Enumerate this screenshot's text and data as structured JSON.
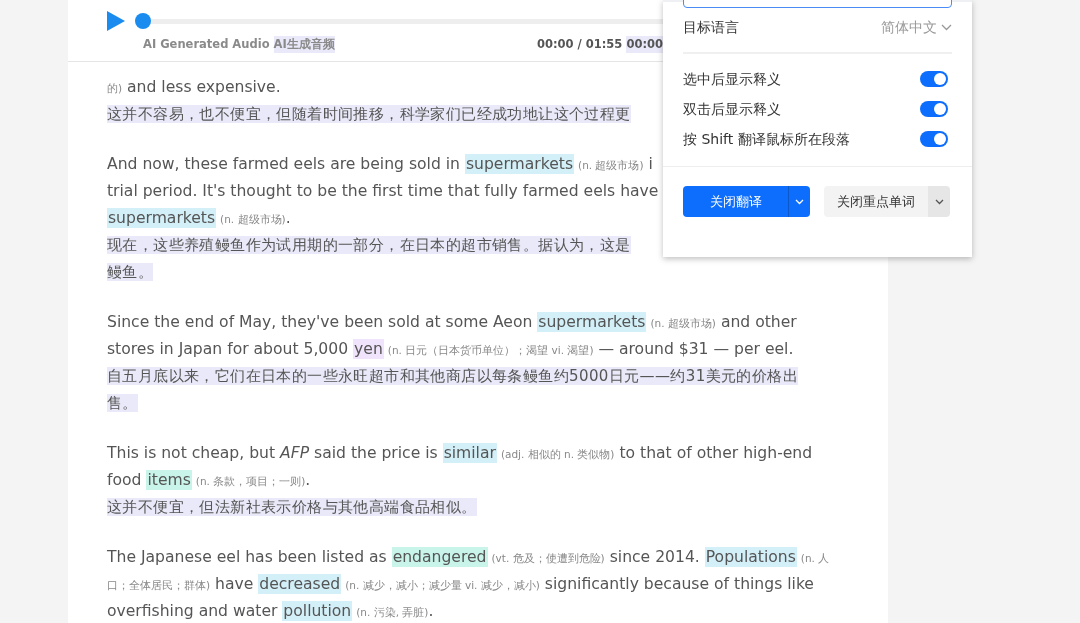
{
  "audio": {
    "label": "AI Generated Audio",
    "label_translation": "AI生成音频",
    "time": "00:00 / 01:55",
    "time_translation": "00:00",
    "level": 0
  },
  "paragraphs": [
    {
      "lines": [
        {
          "kind": "english",
          "segments": [
            {
              "kind": "gloss",
              "text": "的)"
            },
            {
              "kind": "text",
              "text": " and less expensive."
            }
          ]
        },
        {
          "kind": "translation",
          "text": "这并不容易，也不便宜，但随着时间推移，科学家们已经成功地让这个过程更"
        }
      ]
    },
    {
      "lines": [
        {
          "kind": "english",
          "segments": [
            {
              "kind": "text",
              "text": "And now, these farmed eels are being sold in "
            },
            {
              "kind": "word",
              "text": "supermarkets",
              "color": "#d3eff8"
            },
            {
              "kind": "gloss",
              "text": "(n. 超级市场)"
            },
            {
              "kind": "text",
              "text": " i"
            }
          ]
        },
        {
          "kind": "english",
          "segments": [
            {
              "kind": "text",
              "text": "trial period. It's thought to be the first time that fully farmed eels have"
            }
          ]
        },
        {
          "kind": "english",
          "segments": [
            {
              "kind": "word",
              "text": "supermarkets",
              "color": "#d3eff8"
            },
            {
              "kind": "gloss",
              "text": "(n. 超级市场)"
            },
            {
              "kind": "text",
              "text": "."
            }
          ]
        },
        {
          "kind": "translation",
          "text": "现在，这些养殖鳗鱼作为试用期的一部分，在日本的超市销售。据认为，这是"
        },
        {
          "kind": "translation",
          "text": "鳗鱼。"
        }
      ]
    },
    {
      "lines": [
        {
          "kind": "english",
          "segments": [
            {
              "kind": "text",
              "text": "Since the end of May, they've been sold at some Aeon "
            },
            {
              "kind": "word",
              "text": "supermarkets",
              "color": "#d3eff8"
            },
            {
              "kind": "gloss",
              "text": "(n. 超级市场)"
            },
            {
              "kind": "text",
              "text": " and other"
            }
          ]
        },
        {
          "kind": "english",
          "segments": [
            {
              "kind": "text",
              "text": "stores in Japan for about 5,000 "
            },
            {
              "kind": "word",
              "text": "yen",
              "color": "#efe4fb"
            },
            {
              "kind": "gloss",
              "text": "(n. 日元（日本货币单位）；渴望 vi. 渴望)"
            },
            {
              "kind": "text",
              "text": " — around $31 — per eel."
            }
          ]
        },
        {
          "kind": "translation",
          "text": "自五月底以来，它们在日本的一些永旺超市和其他商店以每条鳗鱼约5000日元——约31美元的价格出"
        },
        {
          "kind": "translation",
          "text": "售。"
        }
      ]
    },
    {
      "lines": [
        {
          "kind": "english",
          "segments": [
            {
              "kind": "text",
              "text": "This is not cheap, but "
            },
            {
              "kind": "italic",
              "text": "AFP"
            },
            {
              "kind": "text",
              "text": " said the price is "
            },
            {
              "kind": "word",
              "text": "similar",
              "color": "#d3eff8"
            },
            {
              "kind": "gloss",
              "text": "(adj. 相似的 n. 类似物)"
            },
            {
              "kind": "text",
              "text": " to that of other high-end"
            }
          ]
        },
        {
          "kind": "english",
          "segments": [
            {
              "kind": "text",
              "text": "food "
            },
            {
              "kind": "word",
              "text": "items",
              "color": "#c9f4ea"
            },
            {
              "kind": "gloss",
              "text": "(n. 条款，项目；一则)"
            },
            {
              "kind": "text",
              "text": "."
            }
          ]
        },
        {
          "kind": "translation",
          "text": "这并不便宜，但法新社表示价格与其他高端食品相似。"
        }
      ]
    },
    {
      "lines": [
        {
          "kind": "english",
          "segments": [
            {
              "kind": "text",
              "text": "The Japanese eel has been listed as "
            },
            {
              "kind": "word",
              "text": "endangered",
              "color": "#c9f4ea"
            },
            {
              "kind": "gloss",
              "text": "(vt. 危及；使遭到危险)"
            },
            {
              "kind": "text",
              "text": " since 2014. "
            },
            {
              "kind": "word",
              "text": "Populations",
              "color": "#d3eff8"
            },
            {
              "kind": "gloss",
              "text": "(n. 人"
            }
          ]
        },
        {
          "kind": "english",
          "segments": [
            {
              "kind": "gloss",
              "text": "口；全体居民；群体)"
            },
            {
              "kind": "text",
              "text": " have "
            },
            {
              "kind": "word",
              "text": "decreased",
              "color": "#d3eff8"
            },
            {
              "kind": "gloss",
              "text": "(n. 减少，减小；减少量 vi. 减少，减小)"
            },
            {
              "kind": "text",
              "text": " significantly because of things like"
            }
          ]
        },
        {
          "kind": "english",
          "segments": [
            {
              "kind": "text",
              "text": "overfishing and water "
            },
            {
              "kind": "word",
              "text": "pollution",
              "color": "#d3eff8"
            },
            {
              "kind": "gloss",
              "text": "(n. 污染, 弄脏)"
            },
            {
              "kind": "text",
              "text": "."
            }
          ]
        }
      ]
    }
  ],
  "popup": {
    "language_label": "目标语言",
    "language_value": "简体中文",
    "toggles": [
      {
        "label": "选中后显示释义",
        "on": true
      },
      {
        "label": "双击后显示释义",
        "on": true
      },
      {
        "label": "按 Shift 翻译鼠标所在段落",
        "on": true
      }
    ],
    "buttons": [
      {
        "label": "关闭翻译",
        "kind": "primary"
      },
      {
        "label": "关闭重点单词",
        "kind": "secondary"
      }
    ]
  }
}
